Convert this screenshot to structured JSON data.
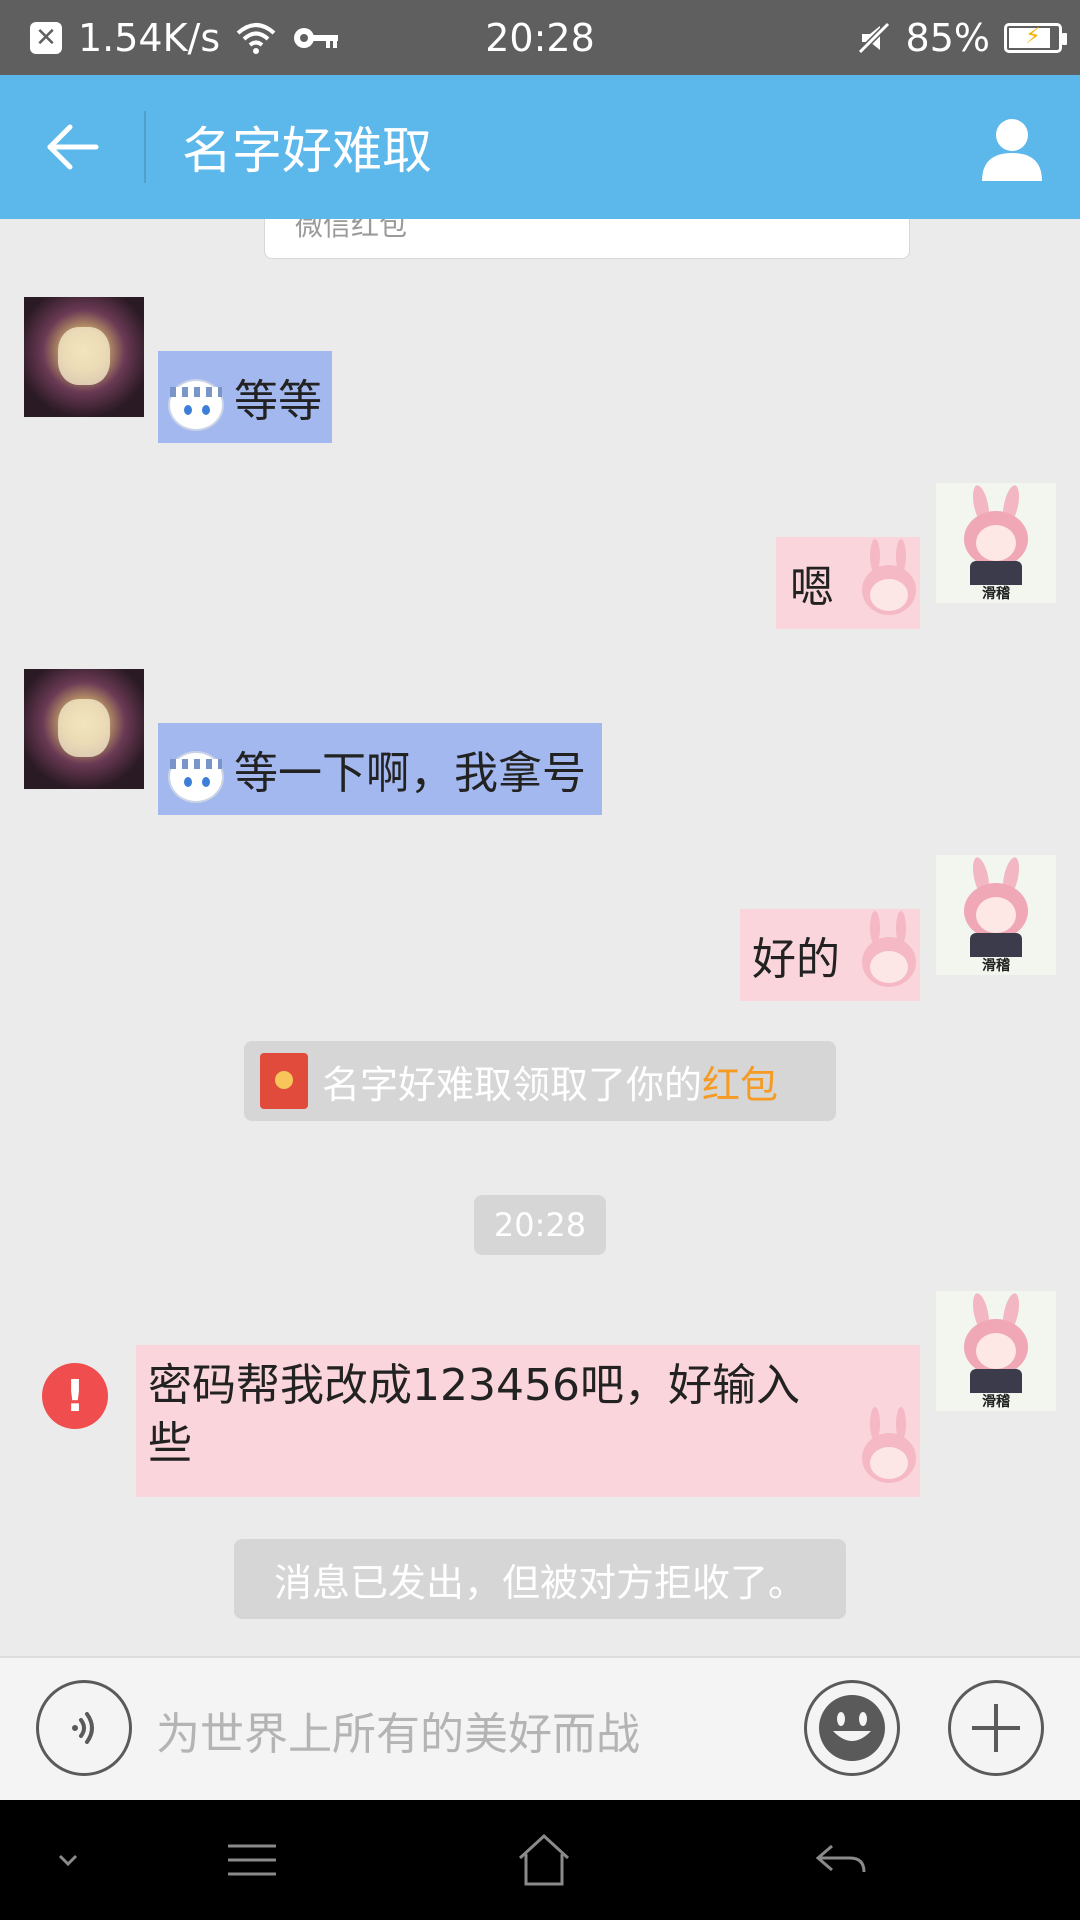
{
  "status_bar": {
    "speed": "1.54K/s",
    "time": "20:28",
    "battery": "85%",
    "battery_level": 0.85
  },
  "header": {
    "title": "名字好难取"
  },
  "chat": {
    "top_card_text": "微信红包",
    "messages": [
      {
        "side": "left",
        "text": "等等"
      },
      {
        "side": "right",
        "text": "嗯"
      },
      {
        "side": "left",
        "text": "等一下啊，我拿号"
      },
      {
        "side": "right",
        "text": "好的"
      }
    ],
    "right_avatar_tag": "滑稽",
    "red_packet_notice": {
      "prefix": "名字好难取领取了你的",
      "highlight": "红包"
    },
    "timestamp": "20:28",
    "failed_message": {
      "text": "密码帮我改成123456吧，好输入些",
      "status_icon": "!"
    },
    "rejection_notice": "消息已发出，但被对方拒收了。"
  },
  "input_bar": {
    "placeholder": "为世界上所有的美好而战"
  },
  "colors": {
    "header_bg": "#5cb7eb",
    "blue_bubble": "#a3b8ef",
    "pink_bubble": "#fad6dc",
    "highlight": "#f59a23",
    "error": "#f04e4e"
  }
}
